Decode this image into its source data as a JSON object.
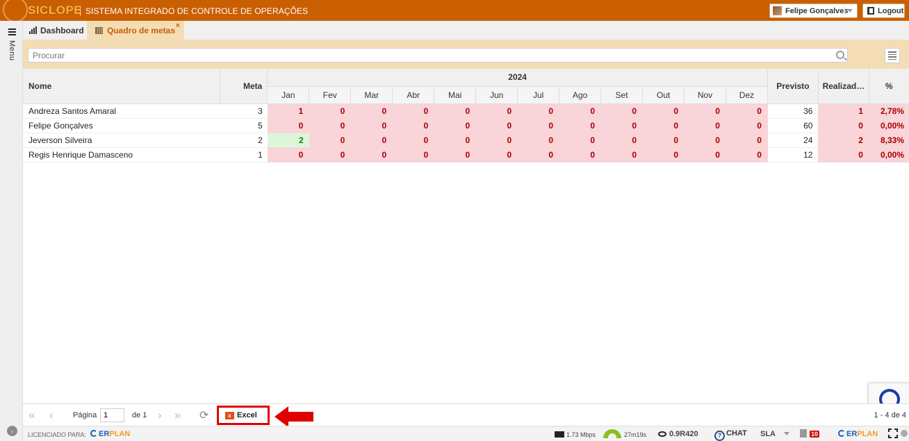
{
  "app": {
    "logo_text": "SICLOPE",
    "system_name": "SISTEMA INTEGRADO DE CONTROLE DE OPERAÇÕES",
    "accent_color": "#c95f00"
  },
  "header": {
    "user_name": "Felipe Gonçalves",
    "logout_label": "Logout"
  },
  "sidebar": {
    "menu_label": "Menu"
  },
  "tabs": [
    {
      "label": "Dashboard",
      "icon": "bar-chart-icon"
    },
    {
      "label": "Quadro de metas",
      "icon": "grid-icon",
      "close": "×"
    }
  ],
  "search": {
    "placeholder": "Procurar",
    "value": ""
  },
  "grid": {
    "columns": {
      "nome": "Nome",
      "meta": "Meta",
      "year": "2024",
      "months": [
        "Jan",
        "Fev",
        "Mar",
        "Abr",
        "Mai",
        "Jun",
        "Jul",
        "Ago",
        "Set",
        "Out",
        "Nov",
        "Dez"
      ],
      "previsto": "Previsto",
      "realizado": "Realizad…",
      "pct": "%"
    },
    "rows": [
      {
        "nome": "Andreza Santos Amaral",
        "meta": "3",
        "months": [
          "1",
          "0",
          "0",
          "0",
          "0",
          "0",
          "0",
          "0",
          "0",
          "0",
          "0",
          "0"
        ],
        "previsto": "36",
        "realizado": "1",
        "pct": "2,78%",
        "highlight": []
      },
      {
        "nome": "Felipe Gonçalves",
        "meta": "5",
        "months": [
          "0",
          "0",
          "0",
          "0",
          "0",
          "0",
          "0",
          "0",
          "0",
          "0",
          "0",
          "0"
        ],
        "previsto": "60",
        "realizado": "0",
        "pct": "0,00%",
        "highlight": []
      },
      {
        "nome": "Jeverson Silveira",
        "meta": "2",
        "months": [
          "2",
          "0",
          "0",
          "0",
          "0",
          "0",
          "0",
          "0",
          "0",
          "0",
          "0",
          "0"
        ],
        "previsto": "24",
        "realizado": "2",
        "pct": "8,33%",
        "highlight": [
          0
        ]
      },
      {
        "nome": "Regis Henrique Damasceno",
        "meta": "1",
        "months": [
          "0",
          "0",
          "0",
          "0",
          "0",
          "0",
          "0",
          "0",
          "0",
          "0",
          "0",
          "0"
        ],
        "previsto": "12",
        "realizado": "0",
        "pct": "0,00%",
        "highlight": []
      }
    ]
  },
  "pager": {
    "page_label": "Página",
    "page_value": "1",
    "of_label": "de 1",
    "excel_label": "Excel",
    "count_label": "1 - 4 de 4"
  },
  "statusbar": {
    "licensed_label": "LICENCIADO PARA:",
    "erplan_left": "ER",
    "erplan_right": "PLAN",
    "speed": "1.73 Mbps",
    "uptime": "27m19s",
    "version": "0.9R420",
    "chat_label": "CHAT",
    "sla_label": "SLA",
    "notif_count": "10"
  }
}
